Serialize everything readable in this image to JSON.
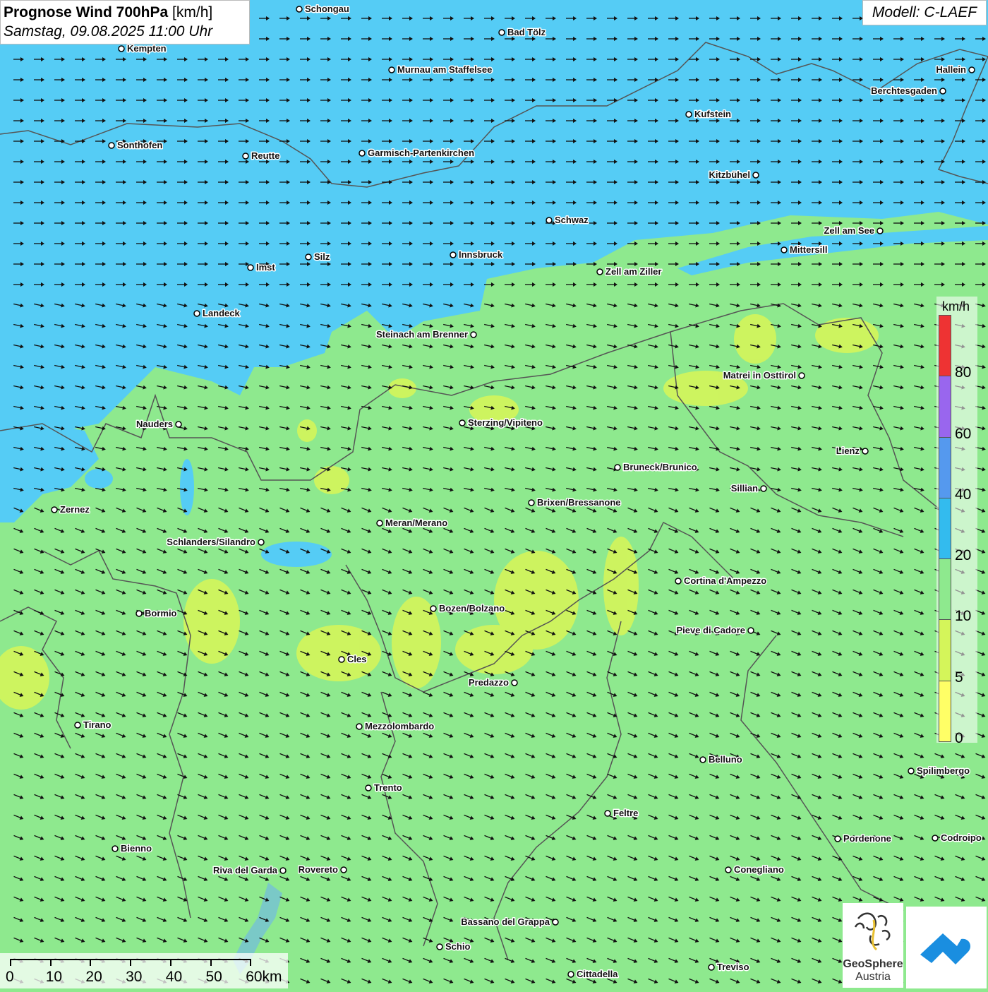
{
  "header": {
    "title_bold": "Prognose Wind 700hPa",
    "title_unit": "[km/h]",
    "datetime": "Samstag, 09.08.2025 11:00 Uhr",
    "model": "Modell: C-LAEF"
  },
  "legend": {
    "unit": "km/h",
    "classes": [
      {
        "min": 0,
        "max": 5,
        "color": "#ffff66"
      },
      {
        "min": 5,
        "max": 10,
        "color": "#d4f55a"
      },
      {
        "min": 10,
        "max": 20,
        "color": "#8ee98e"
      },
      {
        "min": 20,
        "max": 40,
        "color": "#33bbee"
      },
      {
        "min": 40,
        "max": 60,
        "color": "#5599ee"
      },
      {
        "min": 60,
        "max": 80,
        "color": "#9966ee"
      },
      {
        "min": 80,
        "max": 100,
        "color": "#ee3333"
      }
    ],
    "labels": [
      "0",
      "5",
      "10",
      "20",
      "40",
      "60",
      "80"
    ]
  },
  "scalebar": {
    "labels": [
      "0",
      "10",
      "20",
      "30",
      "40",
      "50",
      "60km"
    ]
  },
  "logo": {
    "name": "GeoSphere",
    "country": "Austria"
  },
  "colors": {
    "wind_low": "#ffff66",
    "wind_mid": "#8ee98e",
    "wind_high": "#55ccf5",
    "border": "#555555",
    "arrow": "#111111"
  },
  "wind": {
    "prevailing_direction": "west",
    "arrow_glyph": "arrow"
  },
  "cities": [
    {
      "name": "Schongau"
    },
    {
      "name": "Bad Tölz"
    },
    {
      "name": "Kempten"
    },
    {
      "name": "Murnau am Staffelsee"
    },
    {
      "name": "Hallein"
    },
    {
      "name": "Berchtesgaden"
    },
    {
      "name": "Kufstein"
    },
    {
      "name": "Sonthofen"
    },
    {
      "name": "Reutte"
    },
    {
      "name": "Garmisch-Partenkirchen"
    },
    {
      "name": "Kitzbühel"
    },
    {
      "name": "Schwaz"
    },
    {
      "name": "Zell am See"
    },
    {
      "name": "Mittersill"
    },
    {
      "name": "Innsbruck"
    },
    {
      "name": "Silz"
    },
    {
      "name": "Imst"
    },
    {
      "name": "Zell am Ziller"
    },
    {
      "name": "Landeck"
    },
    {
      "name": "Steinach am Brenner"
    },
    {
      "name": "Matrei in Osttirol"
    },
    {
      "name": "Nauders"
    },
    {
      "name": "Sterzing/Vipiteno"
    },
    {
      "name": "Lienz"
    },
    {
      "name": "Bruneck/Brunico"
    },
    {
      "name": "Sillian"
    },
    {
      "name": "Brixen/Bressanone"
    },
    {
      "name": "Zernez"
    },
    {
      "name": "Meran/Merano"
    },
    {
      "name": "Schlanders/Silandro"
    },
    {
      "name": "Cortina d'Ampezzo"
    },
    {
      "name": "Bozen/Bolzano"
    },
    {
      "name": "Bormio"
    },
    {
      "name": "Pieve di Cadore"
    },
    {
      "name": "Cles"
    },
    {
      "name": "Predazzo"
    },
    {
      "name": "Tirano"
    },
    {
      "name": "Mezzolombardo"
    },
    {
      "name": "Belluno"
    },
    {
      "name": "Spilimbergo"
    },
    {
      "name": "Trento"
    },
    {
      "name": "Feltre"
    },
    {
      "name": "Pordenone"
    },
    {
      "name": "Codroipo"
    },
    {
      "name": "Bienno"
    },
    {
      "name": "Riva del Garda"
    },
    {
      "name": "Rovereto"
    },
    {
      "name": "Conegliano"
    },
    {
      "name": "Bassano del Grappa"
    },
    {
      "name": "Schio"
    },
    {
      "name": "Treviso"
    },
    {
      "name": "Cittadella"
    }
  ]
}
